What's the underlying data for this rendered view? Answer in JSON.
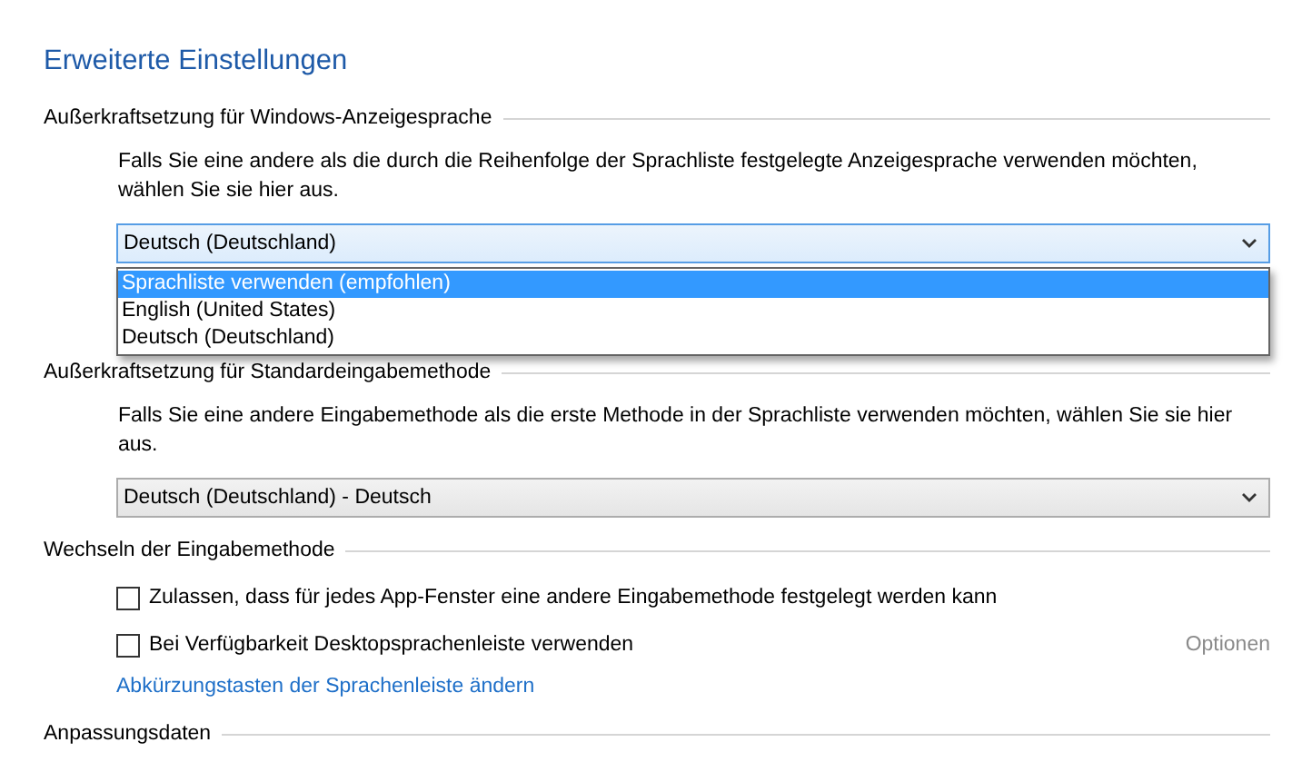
{
  "title": "Erweiterte Einstellungen",
  "sections": [
    {
      "heading": "Außerkraftsetzung für Windows-Anzeigesprache",
      "description": "Falls Sie eine andere als die durch die Reihenfolge der Sprachliste festgelegte Anzeigesprache verwenden möchten, wählen Sie sie hier aus.",
      "dropdown": {
        "value": "Deutsch (Deutschland)",
        "expanded": true,
        "options": [
          {
            "label": "Sprachliste verwenden (empfohlen)",
            "highlighted": true
          },
          {
            "label": "English (United States)",
            "highlighted": false
          },
          {
            "label": "Deutsch (Deutschland)",
            "highlighted": false
          }
        ]
      }
    },
    {
      "heading": "Außerkraftsetzung für Standardeingabemethode",
      "description": "Falls Sie eine andere Eingabemethode als die erste Methode in der Sprachliste verwenden möchten, wählen Sie sie hier aus.",
      "dropdown": {
        "value": "Deutsch (Deutschland) - Deutsch",
        "expanded": false
      }
    },
    {
      "heading": "Wechseln der Eingabemethode",
      "checkboxes": [
        {
          "label": "Zulassen, dass für jedes App-Fenster eine andere Eingabemethode festgelegt werden kann",
          "checked": false
        },
        {
          "label": "Bei Verfügbarkeit Desktopsprachenleiste verwenden",
          "checked": false,
          "action": {
            "label": "Optionen",
            "disabled": true
          }
        }
      ],
      "link": "Abkürzungstasten der Sprachenleiste ändern"
    },
    {
      "heading": "Anpassungsdaten"
    }
  ]
}
